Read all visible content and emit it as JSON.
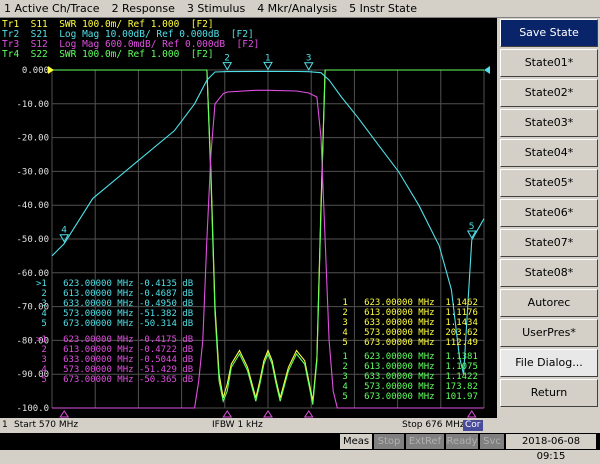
{
  "menu": [
    "1 Active Ch/Trace",
    "2 Response",
    "3 Stimulus",
    "4 Mkr/Analysis",
    "5 Instr State"
  ],
  "traces": [
    {
      "text": "Tr1  S11  SWR 100.0m/ Ref 1.000  [F2]",
      "color": "#ffff40"
    },
    {
      "text": "Tr2  S21  Log Mag 10.00dB/ Ref 0.000dB  [F2]",
      "color": "#4fe0e8"
    },
    {
      "text": "Tr3  S12  Log Mag 600.0mdB/ Ref 0.000dB  [F2]",
      "color": "#e050e0"
    },
    {
      "text": "Tr4  S22  SWR 100.0m/ Ref 1.000  [F2]",
      "color": "#60ff60"
    }
  ],
  "active_trace_label": "F2",
  "yaxis_labels": [
    "0.000",
    "-10.00",
    "-20.00",
    "-30.00",
    "-40.00",
    "-50.00",
    "-60.00",
    "-70.00",
    "-80.00",
    "-90.00",
    "-100.0"
  ],
  "marker_tables": {
    "s21": {
      "color": "#4fe0e8",
      "rows": [
        ">1   623.00000 MHz -0.4135 dB",
        " 2   613.00000 MHz -0.4687 dB",
        " 3   633.00000 MHz -0.4950 dB",
        " 4   573.00000 MHz -51.382 dB",
        " 5   673.00000 MHz -50.314 dB"
      ]
    },
    "s12": {
      "color": "#e050e0",
      "rows": [
        ">1   623.00000 MHz -0.4175 dB",
        " 2   613.00000 MHz -0.4722 dB",
        " 3   633.00000 MHz -0.5044 dB",
        " 4   573.00000 MHz -51.429 dB",
        " 5   673.00000 MHz -50.365 dB"
      ]
    },
    "s11": {
      "color": "#ffff40",
      "rows": [
        " 1   623.00000 MHz  1.1462",
        " 2   613.00000 MHz  1.1176",
        " 3   633.00000 MHz  1.1434",
        " 4   573.00000 MHz  203.62",
        " 5   673.00000 MHz  112.49"
      ]
    },
    "s22": {
      "color": "#60ff60",
      "rows": [
        " 1   623.00000 MHz  1.1381",
        " 2   613.00000 MHz  1.1075",
        " 3   633.00000 MHz  1.1422",
        " 4   573.00000 MHz  173.82",
        " 5   673.00000 MHz  101.97"
      ]
    }
  },
  "softkeys": [
    "Save State",
    "State01*",
    "State02*",
    "State03*",
    "State04*",
    "State05*",
    "State06*",
    "State07*",
    "State08*",
    "Autorec",
    "UserPres*",
    "File Dialog...",
    "Return"
  ],
  "status": {
    "channel": "1",
    "start": "Start 570 MHz",
    "ifbw": "IFBW 1 kHz",
    "stop": "Stop 676 MHz",
    "cor": "Cor",
    "meas": "Meas",
    "stop_label": "Stop",
    "extref": "ExtRef",
    "ready": "Ready",
    "svc": "Svc",
    "datetime": "2018-06-08 09:15"
  },
  "chart_data": {
    "type": "line",
    "xlim": [
      570,
      676
    ],
    "ylim": [
      -100,
      0
    ],
    "x_unit": "MHz",
    "y_unit": "dB",
    "series": [
      {
        "name": "S21",
        "color": "#4fe0e8",
        "x": [
          570,
          573,
          580,
          590,
          600,
          605,
          608,
          610,
          613,
          620,
          623,
          630,
          633,
          636,
          638,
          641,
          645,
          650,
          655,
          660,
          665,
          668,
          670,
          671,
          672,
          673,
          676
        ],
        "y": [
          -55,
          -51.4,
          -38,
          -28,
          -18,
          -10,
          -3,
          -0.6,
          -0.47,
          -0.42,
          -0.41,
          -0.45,
          -0.5,
          -0.8,
          -3,
          -8,
          -14,
          -22,
          -30,
          -40,
          -52,
          -65,
          -85,
          -90,
          -70,
          -50.3,
          -44
        ]
      },
      {
        "name": "S12",
        "color": "#e050e0",
        "x": [
          570,
          605,
          606,
          607,
          608,
          609,
          610,
          612,
          613,
          620,
          623,
          630,
          633,
          635,
          636,
          637,
          638,
          639,
          640,
          676
        ],
        "y": [
          -100,
          -100,
          -92,
          -80,
          -50,
          -25,
          -10,
          -7,
          -6.5,
          -6,
          -6,
          -6.2,
          -6.8,
          -8,
          -20,
          -50,
          -80,
          -95,
          -100,
          -100
        ]
      },
      {
        "name": "S11",
        "color": "#ffff40",
        "x": [
          570,
          608,
          609,
          610,
          611,
          612,
          613,
          614,
          616,
          618,
          620,
          621,
          622,
          623,
          624,
          625,
          626,
          628,
          630,
          632,
          633,
          634,
          635,
          636,
          637,
          676
        ],
        "y": [
          0,
          0,
          -30,
          -70,
          -90,
          -97,
          -93,
          -87,
          -83,
          -88,
          -97,
          -92,
          -86,
          -83,
          -86,
          -92,
          -97,
          -88,
          -83,
          -86,
          -92,
          -98,
          -85,
          -40,
          0,
          0
        ]
      },
      {
        "name": "S22",
        "color": "#60ff60",
        "x": [
          570,
          608,
          609,
          610,
          611,
          612,
          613,
          614,
          616,
          618,
          620,
          621,
          622,
          623,
          624,
          625,
          626,
          628,
          630,
          632,
          633,
          634,
          635,
          636,
          637,
          676
        ],
        "y": [
          0,
          0,
          -32,
          -72,
          -92,
          -98,
          -95,
          -88,
          -84,
          -89,
          -98,
          -93,
          -87,
          -84,
          -87,
          -93,
          -98,
          -89,
          -84,
          -87,
          -93,
          -99,
          -86,
          -42,
          0,
          0
        ]
      }
    ],
    "markers": [
      {
        "id": "1",
        "x": 623
      },
      {
        "id": "2",
        "x": 613
      },
      {
        "id": "3",
        "x": 633
      },
      {
        "id": "4",
        "x": 573
      },
      {
        "id": "5",
        "x": 673
      }
    ]
  }
}
